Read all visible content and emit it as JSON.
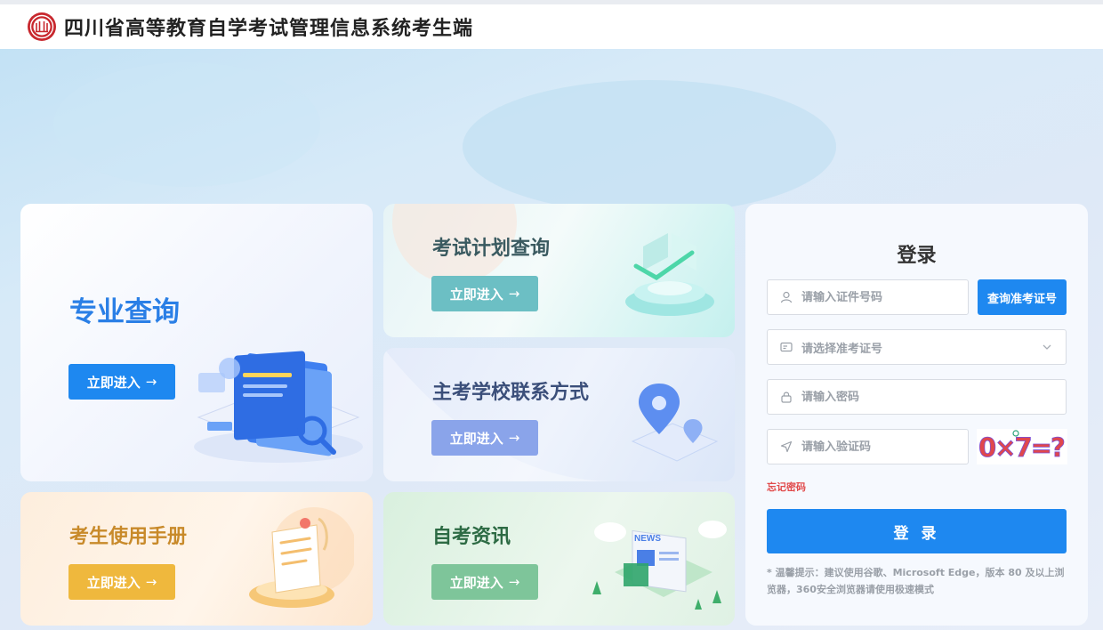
{
  "header": {
    "title": "四川省高等教育自学考试管理信息系统考生端",
    "logo_icon": "university-seal-icon"
  },
  "cards": {
    "enter_label": "立即进入",
    "arrow": "→",
    "major": {
      "title": "专业查询",
      "color": "#2a7fe6"
    },
    "plan": {
      "title": "考试计划查询",
      "color": "#6cbfc4"
    },
    "school": {
      "title": "主考学校联系方式",
      "color": "#8aa4ea"
    },
    "handbook": {
      "title": "考生使用手册",
      "color": "#efb83d"
    },
    "news": {
      "title": "自考资讯",
      "color": "#7ec59a"
    }
  },
  "login": {
    "title": "登录",
    "id_placeholder": "请输入证件号码",
    "query_button": "查询准考证号",
    "ticket_select_placeholder": "请选择准考证号",
    "password_placeholder": "请输入密码",
    "captcha_placeholder": "请输入验证码",
    "captcha_text": "0×7=?",
    "forgot_password": "忘记密码",
    "submit": "登 录",
    "tip": "* 温馨提示：建议使用谷歌、Microsoft Edge，版本 80 及以上浏览器，360安全浏览器请使用极速模式",
    "accent_color": "#1e88f0"
  }
}
